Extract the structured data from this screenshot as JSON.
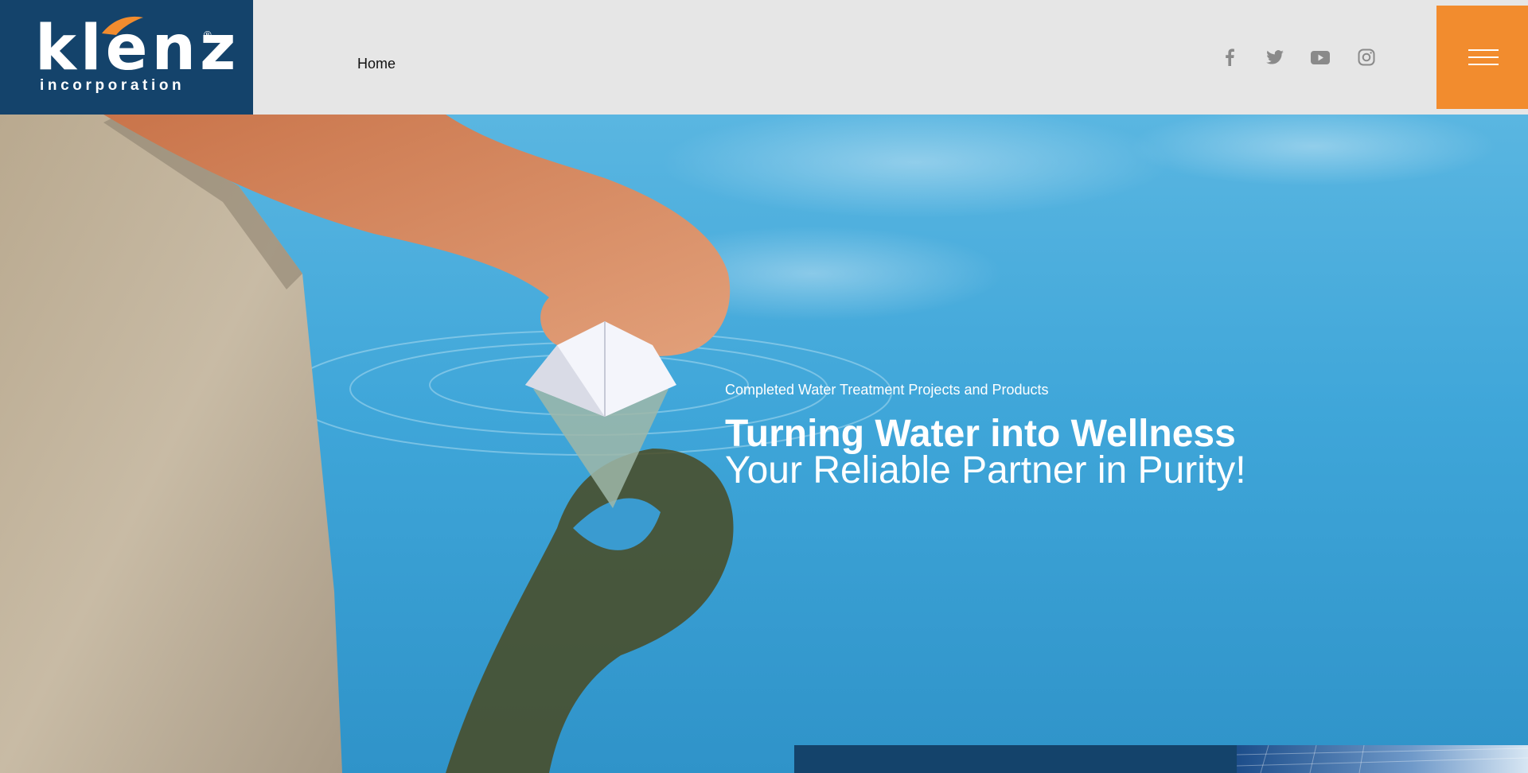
{
  "brand": {
    "logo_word": "klenz",
    "logo_subtitle": "incorporation",
    "registered": "®",
    "colors": {
      "navy": "#14436b",
      "orange": "#f28c2e",
      "header_bg": "#e6e6e6"
    }
  },
  "nav": {
    "items": [
      {
        "label": "Home"
      }
    ]
  },
  "social": [
    {
      "icon": "facebook-icon"
    },
    {
      "icon": "twitter-icon"
    },
    {
      "icon": "youtube-icon"
    },
    {
      "icon": "instagram-icon"
    }
  ],
  "menu": {
    "icon": "hamburger-menu-icon"
  },
  "hero": {
    "subtitle": "Completed Water Treatment Projects and Products",
    "title_line1": "Turning Water into Wellness",
    "title_line2": "Your Reliable Partner in Purity!"
  }
}
